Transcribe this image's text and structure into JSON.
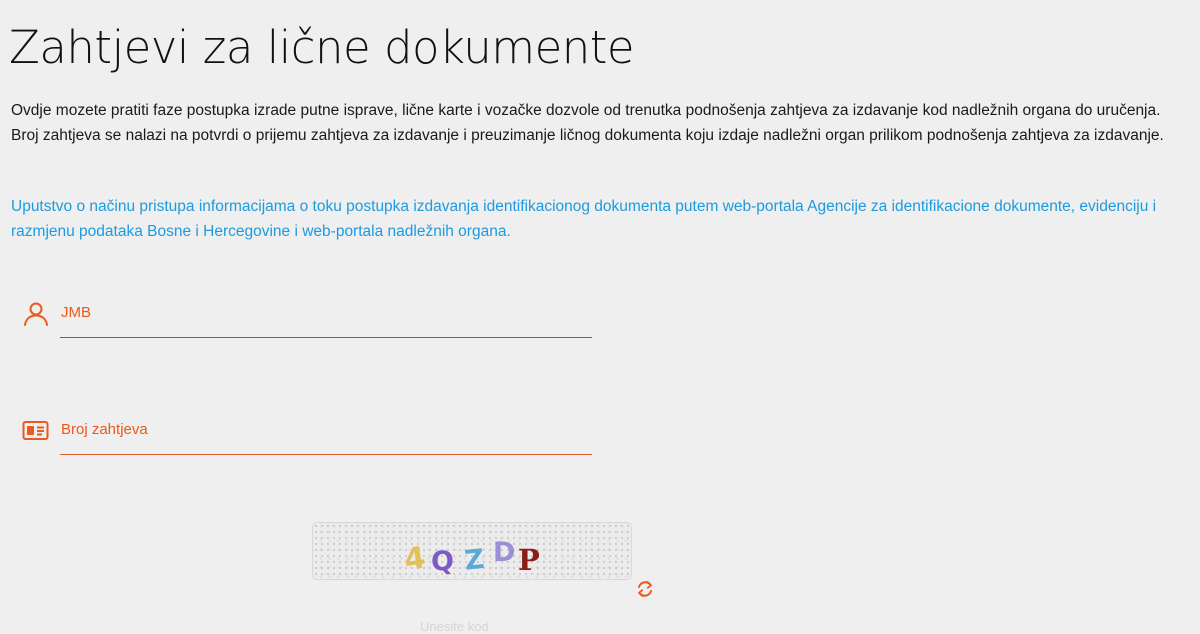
{
  "page": {
    "title": "Zahtjevi za lične dokumente",
    "intro": "Ovdje mozete pratiti faze postupka izrade putne isprave, lične karte i vozačke dozvole od trenutka podnošenja zahtjeva za izdavanje kod nadležnih organa do uručenja. Broj zahtjeva se nalazi na potvrdi o prijemu zahtjeva za izdavanje i preuzimanje ličnog dokumenta koju izdaje nadležni organ prilikom podnošenja zahtjeva za izdavanje.",
    "guide_link": "Uputstvo o načinu pristupa informacijama o toku postupka izdavanja identifikacionog dokumenta putem web-portala Agencije za identifikacione dokumente, evidenciju i razmjenu podataka Bosne i Hercegovine i web-portala nadležnih organa."
  },
  "form": {
    "jmb": {
      "label": "JMB",
      "value": "",
      "icon": "user-icon"
    },
    "broj_zahtjeva": {
      "label": "Broj zahtjeva",
      "value": "",
      "icon": "id-card-icon"
    }
  },
  "captcha": {
    "chars": [
      "4",
      "Q",
      "Z",
      "D",
      "P"
    ],
    "char_colors": [
      "#e2c05a",
      "#7d5bc4",
      "#5aa9d8",
      "#9a90d6",
      "#8b1c16"
    ],
    "refresh_icon": "refresh-icon",
    "hint": "Unesite kod"
  },
  "colors": {
    "accent": "#ea5a1e",
    "link": "#1c9be0",
    "background": "#efefef"
  }
}
